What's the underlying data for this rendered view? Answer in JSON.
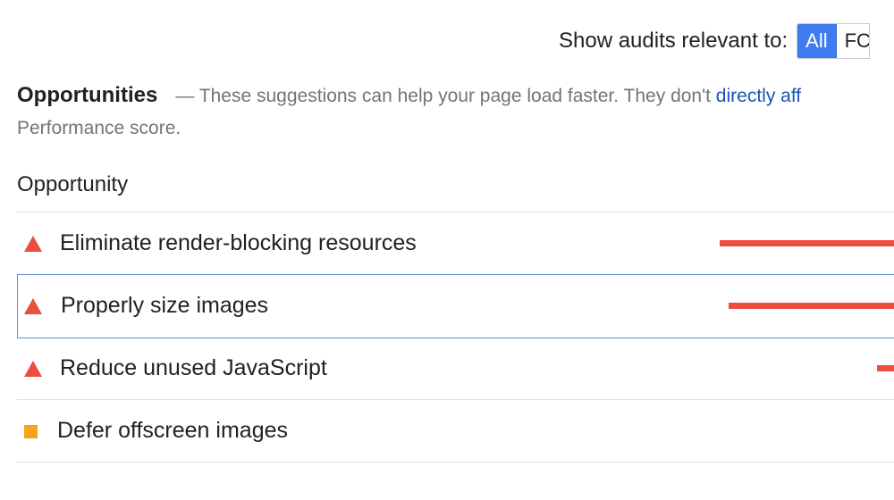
{
  "filter": {
    "label": "Show audits relevant to:",
    "options": [
      "All",
      "FC"
    ],
    "selected": "All"
  },
  "section": {
    "title": "Opportunities",
    "description_prefix": "— These suggestions can help your page load faster. They don't ",
    "description_link": "directly aff",
    "description_line2": "Performance score."
  },
  "column_header": "Opportunity",
  "colors": {
    "fail": "#eb4e3d",
    "average": "#f4a51c",
    "active_chip": "#3f7bf0",
    "link": "#1a55b5"
  },
  "audits": [
    {
      "title": "Eliminate render-blocking resources",
      "status": "fail",
      "icon": "warning-triangle-icon",
      "savings_fraction": 0.81
    },
    {
      "title": "Properly size images",
      "status": "fail",
      "icon": "warning-triangle-icon",
      "savings_fraction": 0.77,
      "focused": true
    },
    {
      "title": "Reduce unused JavaScript",
      "status": "fail",
      "icon": "warning-triangle-icon",
      "savings_fraction": 0.08
    },
    {
      "title": "Defer offscreen images",
      "status": "average",
      "icon": "average-square-icon",
      "savings_fraction": 0
    }
  ]
}
